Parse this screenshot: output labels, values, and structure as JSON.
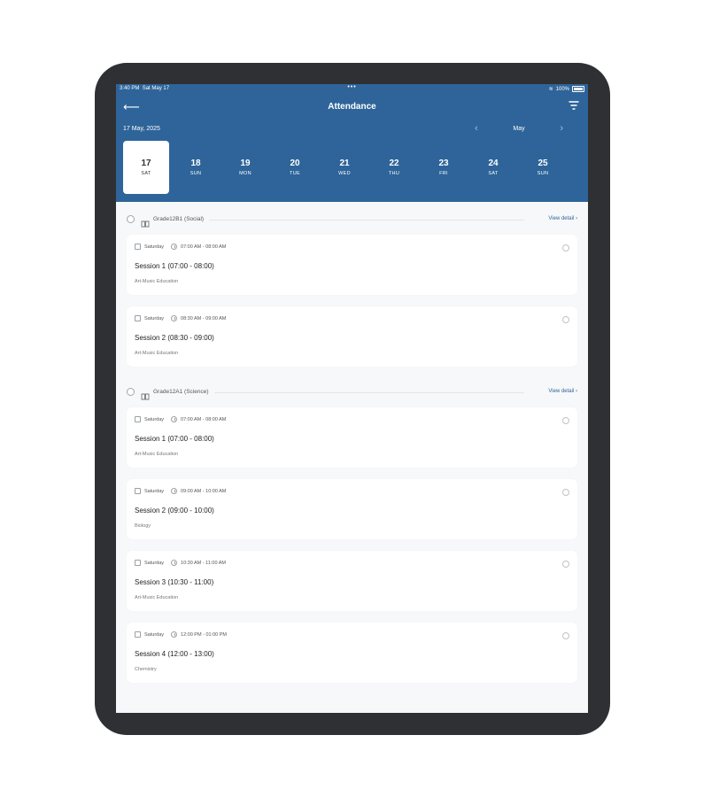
{
  "status_bar": {
    "time": "3:40 PM",
    "date": "Sat May 17",
    "battery": "100%"
  },
  "header": {
    "title": "Attendance",
    "date_label": "17 May, 2025",
    "month": "May"
  },
  "days": [
    {
      "num": "17",
      "weekday": "SAT",
      "selected": true
    },
    {
      "num": "18",
      "weekday": "SUN"
    },
    {
      "num": "19",
      "weekday": "MON"
    },
    {
      "num": "20",
      "weekday": "TUE"
    },
    {
      "num": "21",
      "weekday": "WED"
    },
    {
      "num": "22",
      "weekday": "THU"
    },
    {
      "num": "23",
      "weekday": "FRI"
    },
    {
      "num": "24",
      "weekday": "SAT"
    },
    {
      "num": "25",
      "weekday": "SUN"
    }
  ],
  "groups": [
    {
      "name": "Grade12B1 (Social)",
      "view_detail": "View detail",
      "sessions": [
        {
          "day": "Saturday",
          "time": "07:00 AM - 08:00 AM",
          "title": "Session 1 (07:00 - 08:00)",
          "subject": "Art-Music Education"
        },
        {
          "day": "Saturday",
          "time": "08:30 AM - 09:00 AM",
          "title": "Session 2 (08:30 - 09:00)",
          "subject": "Art-Music Education"
        }
      ]
    },
    {
      "name": "Grade12A1 (Science)",
      "view_detail": "View detail",
      "sessions": [
        {
          "day": "Saturday",
          "time": "07:00 AM - 08:00 AM",
          "title": "Session 1 (07:00 - 08:00)",
          "subject": "Art-Music Education"
        },
        {
          "day": "Saturday",
          "time": "09:00 AM - 10:00 AM",
          "title": "Session 2 (09:00 - 10:00)",
          "subject": "Biology"
        },
        {
          "day": "Saturday",
          "time": "10:30 AM - 11:00 AM",
          "title": "Session 3 (10:30 - 11:00)",
          "subject": "Art-Music Education"
        },
        {
          "day": "Saturday",
          "time": "12:00 PM - 01:00 PM",
          "title": "Session 4 (12:00 - 13:00)",
          "subject": "Chemistry"
        }
      ]
    }
  ]
}
